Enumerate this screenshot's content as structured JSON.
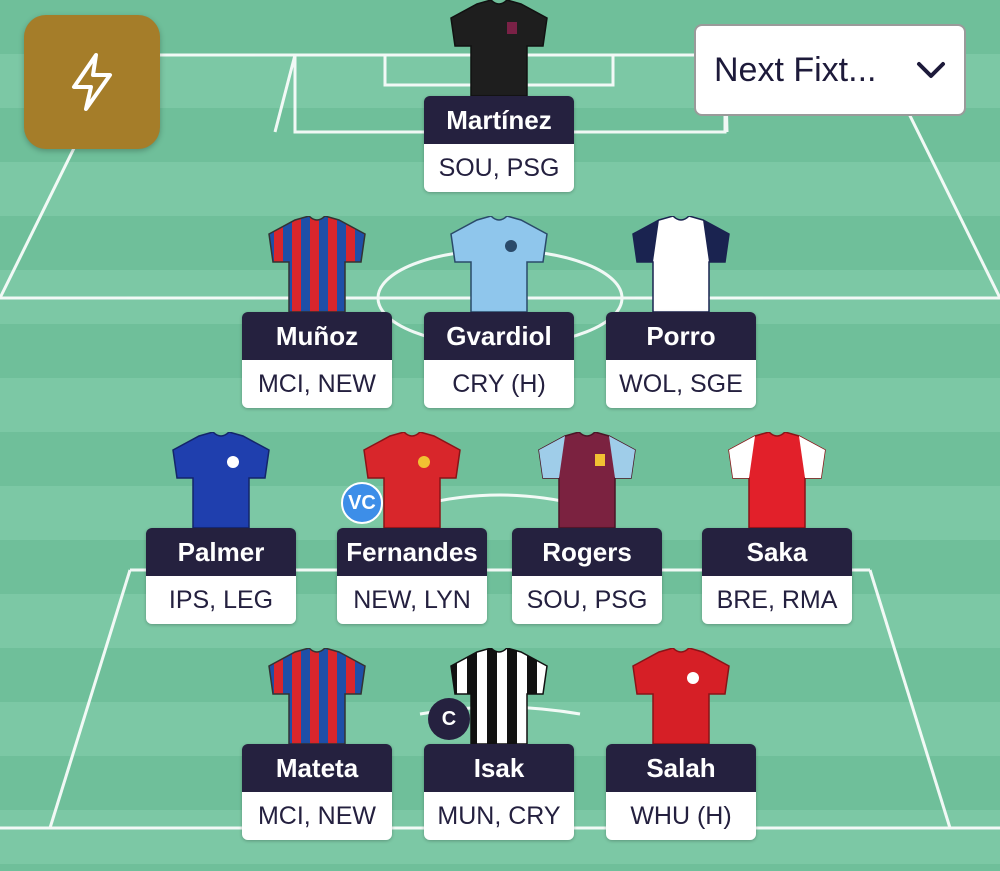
{
  "chip_button": {
    "icon": "lightning-bolt-icon",
    "color": "#a57d29"
  },
  "fixture_select": {
    "selected": "Next Fixt..."
  },
  "colors": {
    "pitch_dark": "#6fbf9a",
    "pitch_light": "#7cc8a5",
    "card_dark": "#25213f",
    "vice_captain": "#3d8ee8"
  },
  "players": [
    {
      "name": "Martínez",
      "fixtures": "SOU, PSG",
      "kit": "goalkeeper-black"
    },
    {
      "name": "Muñoz",
      "fixtures": "MCI, NEW",
      "kit": "crystal-palace"
    },
    {
      "name": "Gvardiol",
      "fixtures": "CRY (H)",
      "kit": "man-city"
    },
    {
      "name": "Porro",
      "fixtures": "WOL, SGE",
      "kit": "tottenham"
    },
    {
      "name": "Palmer",
      "fixtures": "IPS, LEG",
      "kit": "chelsea"
    },
    {
      "name": "Fernandes",
      "fixtures": "NEW, LYN",
      "kit": "man-utd",
      "badge": "VC"
    },
    {
      "name": "Rogers",
      "fixtures": "SOU, PSG",
      "kit": "aston-villa"
    },
    {
      "name": "Saka",
      "fixtures": "BRE, RMA",
      "kit": "arsenal"
    },
    {
      "name": "Mateta",
      "fixtures": "MCI, NEW",
      "kit": "crystal-palace"
    },
    {
      "name": "Isak",
      "fixtures": "MUN, CRY",
      "kit": "newcastle",
      "badge": "C"
    },
    {
      "name": "Salah",
      "fixtures": "WHU (H)",
      "kit": "liverpool"
    }
  ]
}
